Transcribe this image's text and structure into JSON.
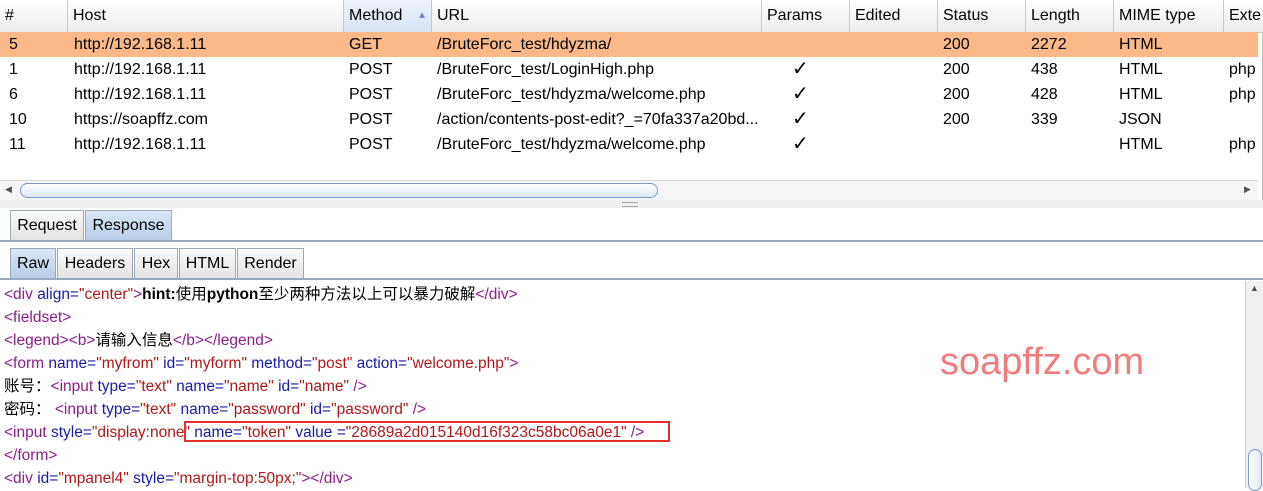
{
  "table": {
    "columns": [
      {
        "label": "#"
      },
      {
        "label": "Host"
      },
      {
        "label": "Method",
        "sorted": "ascending"
      },
      {
        "label": "URL"
      },
      {
        "label": "Params"
      },
      {
        "label": "Edited"
      },
      {
        "label": "Status"
      },
      {
        "label": "Length"
      },
      {
        "label": "MIME type"
      },
      {
        "label": "Exte"
      }
    ],
    "rows": [
      {
        "num": "5",
        "host": "http://192.168.1.11",
        "method": "GET",
        "url": "/BruteForc_test/hdyzma/",
        "params": "",
        "edited": "",
        "status": "200",
        "length": "2272",
        "mime": "HTML",
        "ext": "",
        "selected": true
      },
      {
        "num": "1",
        "host": "http://192.168.1.11",
        "method": "POST",
        "url": "/BruteForc_test/LoginHigh.php",
        "params": "✓",
        "edited": "",
        "status": "200",
        "length": "438",
        "mime": "HTML",
        "ext": "php"
      },
      {
        "num": "6",
        "host": "http://192.168.1.11",
        "method": "POST",
        "url": "/BruteForc_test/hdyzma/welcome.php",
        "params": "✓",
        "edited": "",
        "status": "200",
        "length": "428",
        "mime": "HTML",
        "ext": "php"
      },
      {
        "num": "10",
        "host": "https://soapffz.com",
        "method": "POST",
        "url": "/action/contents-post-edit?_=70fa337a20bd...",
        "params": "✓",
        "edited": "",
        "status": "200",
        "length": "339",
        "mime": "JSON",
        "ext": ""
      },
      {
        "num": "11",
        "host": "http://192.168.1.11",
        "method": "POST",
        "url": "/BruteForc_test/hdyzma/welcome.php",
        "params": "✓",
        "edited": "",
        "status": "",
        "length": "",
        "mime": "HTML",
        "ext": "php"
      }
    ]
  },
  "tabs": {
    "main": [
      "Request",
      "Response"
    ],
    "main_active": "Response",
    "view": [
      "Raw",
      "Headers",
      "Hex",
      "HTML",
      "Render"
    ],
    "view_active": "Raw"
  },
  "response": {
    "line1": {
      "open": "<div ",
      "attr": "align=",
      "val": "\"center\"",
      "close": ">",
      "bold1": "hint:",
      "t1": "使用",
      "bold2": "python",
      "t2": "至少两种方法以上可以暴力破解",
      "end": "</div>"
    },
    "line2": "<fieldset>",
    "line3": {
      "a": "<legend><b>",
      "t": "请输入信息",
      "b": "</b></legend>"
    },
    "line4": {
      "tag": "<form ",
      "a1": "name=",
      "v1": "\"myfrom\"",
      "a2": " id=",
      "v2": "\"myform\"",
      "a3": " method=",
      "v3": "\"post\"",
      "a4": " action=",
      "v4": "\"welcome.php\"",
      "end": ">"
    },
    "line5": {
      "label": "账号：",
      "tag": "<input ",
      "a1": "type=",
      "v1": "\"text\"",
      "a2": " name=",
      "v2": "\"name\"",
      "a3": " id=",
      "v3": "\"name\"",
      "end": " />"
    },
    "line6": {
      "label": "密码：",
      "tag": " <input ",
      "a1": "type=",
      "v1": "\"text\"",
      "a2": " name=",
      "v2": "\"password\"",
      "a3": " id=",
      "v3": "\"password\"",
      "end": " />"
    },
    "line7": {
      "tag": "<input ",
      "a1": "style=",
      "v1": "\"display:none\"",
      "a2": " name=",
      "v2": "\"token\"",
      "a3": " value =",
      "v3": "\"28689a2d015140d16f323c58bc06a0e1\"",
      "end": " />"
    },
    "line8": "</form>",
    "line9": {
      "tag": "<div ",
      "a1": "id=",
      "v1": "\"mpanel4\"",
      "a2": " style=",
      "v2": "\"margin-top:50px;\"",
      "end": "></div>"
    },
    "watermark": "soapffz.com"
  },
  "colors": {
    "selected_row": "#fbb98a",
    "tag": "#8c1e8c",
    "attribute": "#1a1aa6",
    "value": "#b01818",
    "highlight_box": "#e23030",
    "watermark": "#f07c7c"
  }
}
